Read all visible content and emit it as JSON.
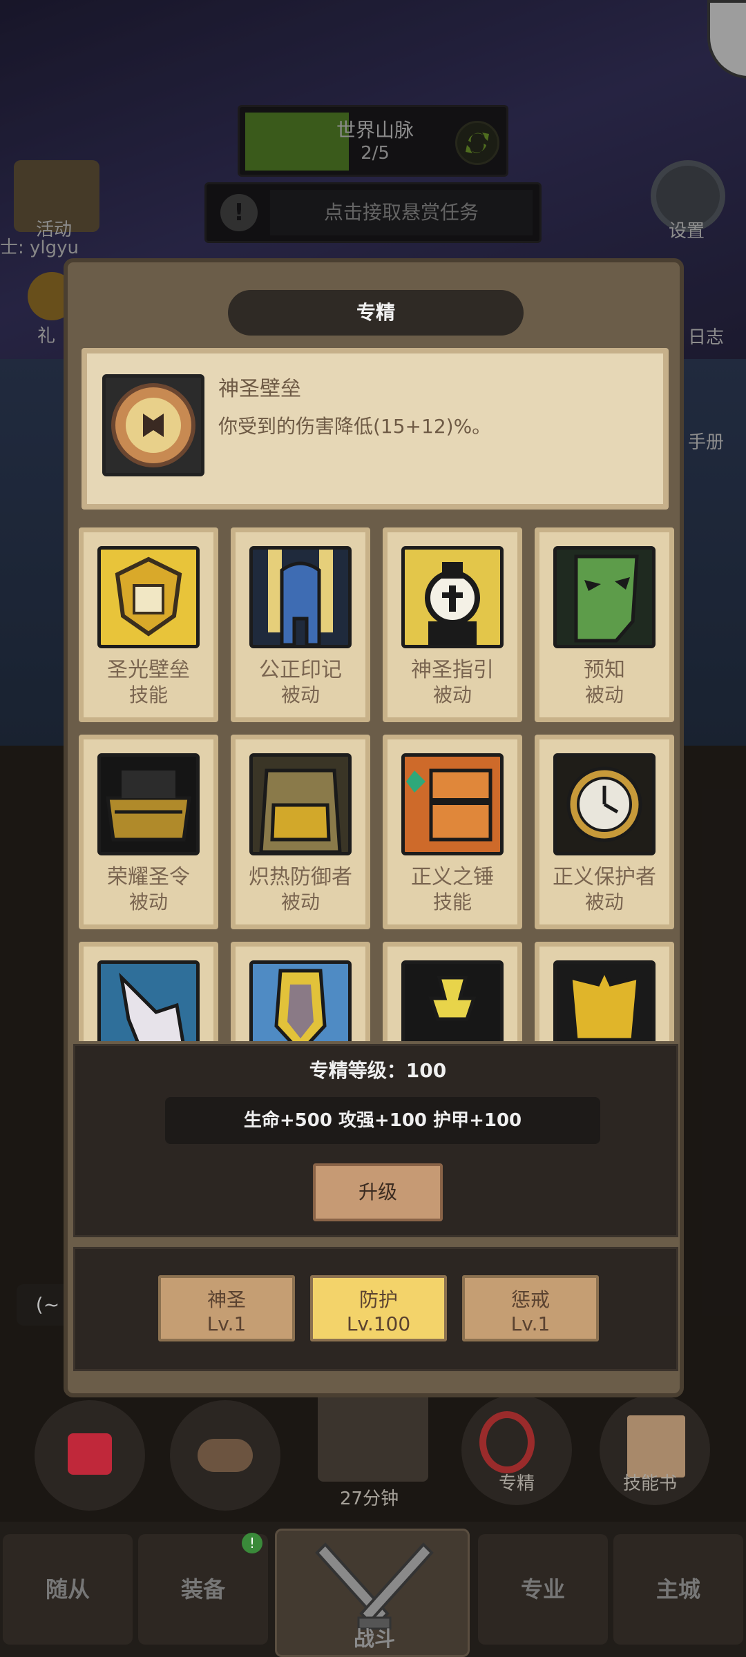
{
  "hud": {
    "world_title": "世界山脉",
    "world_count": "2/5",
    "bounty_label": "点击接取悬赏任务",
    "activity_label": "活动",
    "player_name": "士: ylgyu",
    "gift_label": "礼",
    "settings_label": "设置",
    "log_label": "日志",
    "handbook_label": "手册"
  },
  "dialog": {
    "title": "专精",
    "selected": {
      "name": "神圣壁垒",
      "description": "你受到的伤害降低(15+12)%。"
    },
    "skills": [
      {
        "name": "圣光壁垒",
        "type": "技能"
      },
      {
        "name": "公正印记",
        "type": "被动"
      },
      {
        "name": "神圣指引",
        "type": "被动"
      },
      {
        "name": "预知",
        "type": "被动"
      },
      {
        "name": "荣耀圣令",
        "type": "被动"
      },
      {
        "name": "炽热防御者",
        "type": "被动"
      },
      {
        "name": "正义之锤",
        "type": "技能"
      },
      {
        "name": "正义保护者",
        "type": "被动"
      }
    ],
    "level_text": "专精等级：100",
    "stats_text": "生命+500 攻强+100 护甲+100",
    "upgrade_label": "升级",
    "tabs": [
      {
        "name": "神圣",
        "level": "Lv.1"
      },
      {
        "name": "防护",
        "level": "Lv.100"
      },
      {
        "name": "惩戒",
        "level": "Lv.1"
      }
    ]
  },
  "bottom": {
    "chest_timer": "27分钟",
    "specialization_label": "专精",
    "skill_book_label": "技能书",
    "partial_left": "(~"
  },
  "nav": [
    "随从",
    "装备",
    "战斗",
    "专业",
    "主城"
  ],
  "colors": {
    "active_tab": "#f3d36a",
    "inactive_tab": "#c59e73",
    "card_bg": "#e2d1ab",
    "panel_dark": "#2c2622"
  }
}
